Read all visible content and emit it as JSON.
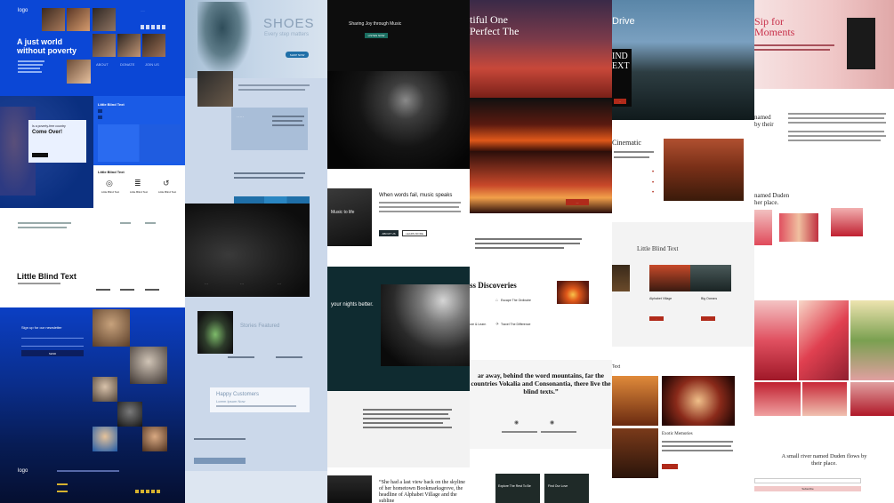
{
  "col1": {
    "logo": "logo",
    "hero_title": "A just world without poverty",
    "nav_about": "ABOUT",
    "nav_donate": "DONATE",
    "nav_join": "JOIN US",
    "question": "Is a poverty-free country",
    "come_over": "Come Over!",
    "panel_title": "Little Blind Text",
    "feat_title": "Little Blind Text",
    "feat1": "Little Blind Text",
    "feat2": "Little Blind Text",
    "feat3": "Little Blind Text",
    "big_title": "Little Blind Text",
    "newsletter": "Sign up for our newsletter",
    "send_btn": "SEND",
    "footer_logo": "logo",
    "colors": {
      "blue": "#0a4ad8",
      "panel": "#1a5be6"
    }
  },
  "col2": {
    "title": "SHOES",
    "subtitle": "Every step matters",
    "shop_btn": "SHOP NOW",
    "stories": "Stories Featured",
    "happy": "Happy Customers",
    "happy_sub": "Lorem Ipsum Now"
  },
  "col3": {
    "header": "Sharing Joy through Music",
    "header_btn": "LISTEN NOW",
    "words_title": "When words fail, music speaks",
    "btn1": "ABOUT US",
    "btn2": "LEARN MORE",
    "music_side": "Music to life",
    "nights": "your nights better.",
    "quote": "“She had a last view back on the skyline of her hometown Bookmarksgrove, the headline of Alphabet Village and the subline"
  },
  "col4": {
    "hero": "tiful One\nPerfect The",
    "discoveries": "ss Discoveries",
    "item1": "Escape The Ordinaire",
    "item2": "Travel The Difference",
    "item3": "ore & Learn",
    "quote": "ar away, behind the word mountains, far the countries Vokalia and Consonantia, there live the blind texts.”",
    "card1": "Explore The Rest To Be",
    "card2": "Find Our Love"
  },
  "col5": {
    "drive": "Drive",
    "ind": "IND\nEXT",
    "cinematic": "Cinematic",
    "little": "Little Blind Text",
    "alphabet": "Alphabet Village",
    "big_ocean": "Big Oceans",
    "small_text": "Text",
    "exotic": "Exotic Memories",
    "caption": "From all our tours Overland Ipsum Dolor Sit"
  },
  "col6": {
    "hero": "Sip for\nMoments",
    "named": "named\nby their",
    "duden": "named Duden\nher place.",
    "footer": "A small river named Duden flows by\ntheir place.",
    "btn": "Subscribe"
  }
}
